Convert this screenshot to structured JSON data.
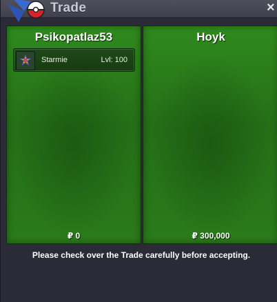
{
  "window": {
    "title": "Trade",
    "close_label": "×",
    "logo_icon": "pokeball-logo-icon"
  },
  "players": [
    {
      "name": "Psikopatlaz53",
      "offer": [
        {
          "pokemon": "Starmie",
          "level": "Lvl: 100",
          "icon": "starmie-icon"
        }
      ],
      "money": "₽ 0"
    },
    {
      "name": "Hoyk",
      "offer": [],
      "money": "₽ 300,000"
    }
  ],
  "notice": "Please check over the Trade carefully before accepting.",
  "colors": {
    "panel_green": "#2a7a1a",
    "window_bg": "#2b2b38",
    "titlebar": "#4a4a57"
  }
}
